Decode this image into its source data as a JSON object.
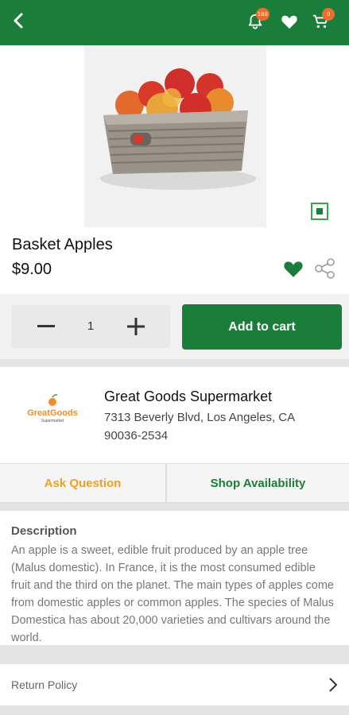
{
  "header": {
    "notifications_badge": "188",
    "cart_badge": "0",
    "bar_color": "#1b7d3a"
  },
  "product": {
    "name": "Basket Apples",
    "price": "$9.00",
    "image": "basket-of-apples"
  },
  "cart": {
    "quantity": "1",
    "add_to_cart_label": "Add to cart"
  },
  "store": {
    "logo_text": "GreatGoods",
    "logo_subtext": "Supermarket",
    "name": "Great Goods Supermarket",
    "address_line1": "7313 Beverly Blvd, Los Angeles, CA",
    "address_line2": "90036-2534"
  },
  "tabs": [
    {
      "label": "Ask Question",
      "color": "#f0a020"
    },
    {
      "label": "Shop Availability",
      "color": "#1b7d3a"
    }
  ],
  "description": {
    "title": "Description",
    "text": "An apple is a sweet, edible fruit produced by an apple tree (Malus domestic). In France, it is the most consumed edible fruit and the third on the planet. The main types of apples come from domestic apples or common apples. The species of Malus Domestica has about 20,000 varieties and cultivars around the world."
  },
  "footer": {
    "return_policy_label": "Return Policy"
  }
}
